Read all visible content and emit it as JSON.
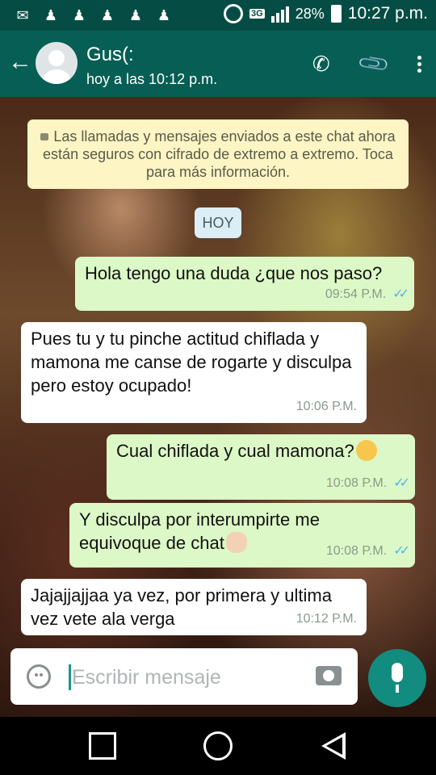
{
  "status_bar": {
    "notification_icons": [
      "chat-notification-icon",
      "add-user-icon",
      "add-user-icon",
      "add-user-icon",
      "add-user-icon",
      "add-user-icon"
    ],
    "network": "3G",
    "battery": "28%",
    "time": "10:27 p.m."
  },
  "header": {
    "contact_name": "Gus(:",
    "last_seen": "hoy a las 10:12 p.m."
  },
  "chat": {
    "system_notice": "Las llamadas y mensajes enviados a este chat ahora están seguros con cifrado de extremo a extremo. Toca para más información.",
    "date_chip": "HOY",
    "messages": [
      {
        "direction": "out",
        "text": "Hola tengo una duda ¿que nos paso?",
        "time": "09:54 P.M.",
        "status": "read"
      },
      {
        "direction": "in",
        "text": "Pues tu y tu pinche actitud chiflada y mamona me canse de rogarte y disculpa pero estoy ocupado!",
        "time": "10:06 P.M."
      },
      {
        "direction": "out",
        "text": "Cual chiflada y cual mamona?",
        "emoji": "thinking-face",
        "time": "10:08 P.M.",
        "status": "read"
      },
      {
        "direction": "out",
        "text": "Y disculpa por interumpirte me equivoque de chat",
        "emoji": "victory-hand",
        "time": "10:08 P.M.",
        "status": "read"
      },
      {
        "direction": "in",
        "text": "Jajajjajjaa ya vez, por primera y ultima vez vete ala verga",
        "time": "10:12 P.M."
      }
    ]
  },
  "composer": {
    "placeholder": "Escribir mensaje"
  },
  "colors": {
    "header": "#075e54",
    "status_bar": "#054d44",
    "outgoing_bubble": "#dcf8c6",
    "incoming_bubble": "#ffffff",
    "read_ticks": "#4fb3f6",
    "mic_button": "#128c7e"
  }
}
